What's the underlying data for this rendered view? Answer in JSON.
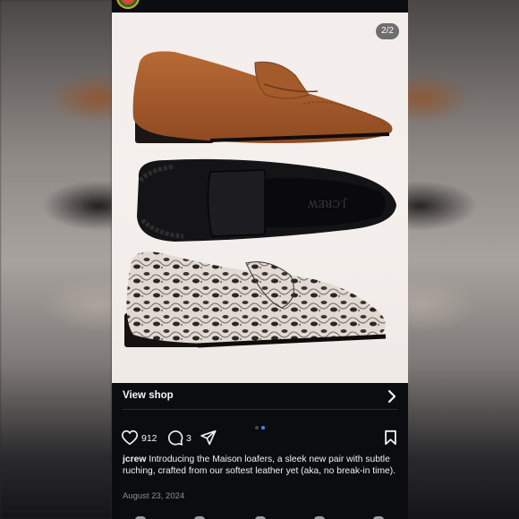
{
  "post": {
    "image_counter": "2/2",
    "view_shop_label": "View shop",
    "likes": "912",
    "comments": "3",
    "caption_user": "jcrew",
    "caption_text": "Introducing the Maison loafers, a sleek new pair with subtle ruching, crafted from our softest leather yet (aka, no break-in time).",
    "date": "August 23, 2024",
    "insole_brand": "J.CREW"
  },
  "carousel": {
    "active_index": 1,
    "total": 2
  },
  "icons": {
    "avatar": "profile-avatar",
    "view_shop_chevron": "chevron-right-icon",
    "like": "heart-icon",
    "comment": "comment-bubble-icon",
    "share": "send-icon",
    "save": "bookmark-icon"
  },
  "colors": {
    "background": "#0b0c10",
    "text": "#f1f1f1",
    "muted": "#8d8e93",
    "dot_active": "#3b8cf6",
    "dot_inactive": "#4a4b50",
    "shoe_tan": "#a25a2b",
    "shoe_black": "#141416",
    "shoe_snake": "#d8cfc6"
  }
}
